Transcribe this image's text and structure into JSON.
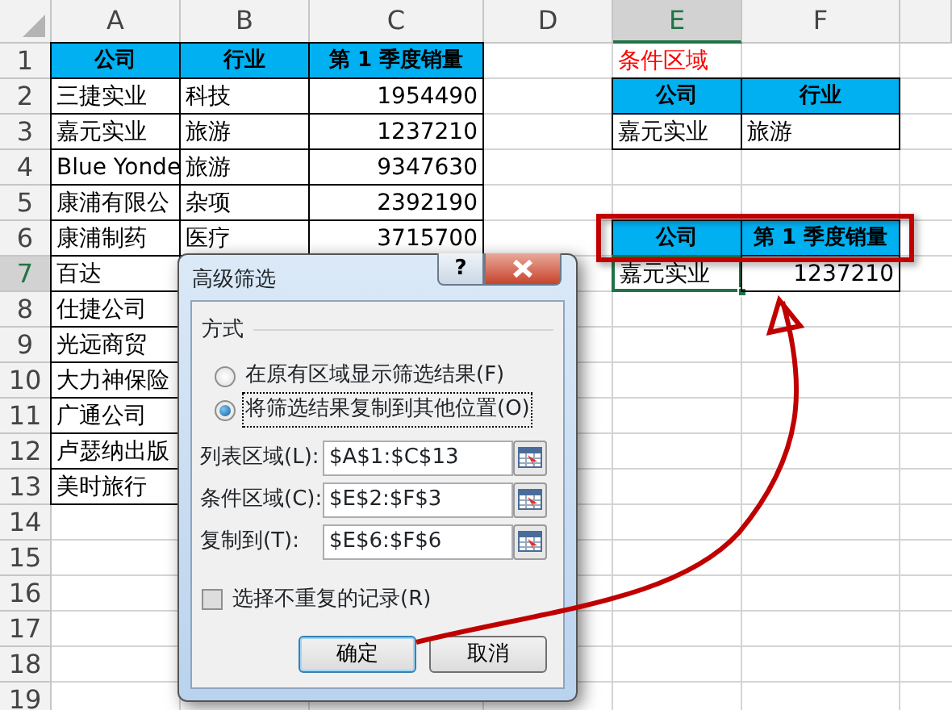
{
  "columns": [
    {
      "label": "A",
      "selected": false
    },
    {
      "label": "B",
      "selected": false
    },
    {
      "label": "C",
      "selected": false
    },
    {
      "label": "D",
      "selected": false
    },
    {
      "label": "E",
      "selected": true
    },
    {
      "label": "F",
      "selected": false
    }
  ],
  "rows": [
    {
      "label": "1",
      "selected": false,
      "cells": {
        "A": {
          "kind": "header",
          "text": "公司"
        },
        "B": {
          "kind": "header",
          "text": "行业"
        },
        "C": {
          "kind": "header",
          "text": "第 1 季度销量"
        },
        "E": {
          "kind": "note",
          "text": "条件区域"
        }
      }
    },
    {
      "label": "2",
      "selected": false,
      "cells": {
        "A": {
          "kind": "text",
          "text": "三捷实业"
        },
        "B": {
          "kind": "text",
          "text": "科技"
        },
        "C": {
          "kind": "number",
          "text": "1954490"
        },
        "E": {
          "kind": "header",
          "text": "公司"
        },
        "F": {
          "kind": "header",
          "text": "行业"
        }
      }
    },
    {
      "label": "3",
      "selected": false,
      "cells": {
        "A": {
          "kind": "text",
          "text": "嘉元实业"
        },
        "B": {
          "kind": "text",
          "text": "旅游"
        },
        "C": {
          "kind": "number",
          "text": "1237210"
        },
        "E": {
          "kind": "text",
          "text": "嘉元实业"
        },
        "F": {
          "kind": "text",
          "text": "旅游"
        }
      }
    },
    {
      "label": "4",
      "selected": false,
      "cells": {
        "A": {
          "kind": "text",
          "text": "Blue Yonde"
        },
        "B": {
          "kind": "text",
          "text": "旅游"
        },
        "C": {
          "kind": "number",
          "text": "9347630"
        }
      }
    },
    {
      "label": "5",
      "selected": false,
      "cells": {
        "A": {
          "kind": "text",
          "text": "康浦有限公"
        },
        "B": {
          "kind": "text",
          "text": "杂项"
        },
        "C": {
          "kind": "number",
          "text": "2392190"
        }
      }
    },
    {
      "label": "6",
      "selected": false,
      "cells": {
        "A": {
          "kind": "text",
          "text": "康浦制药"
        },
        "B": {
          "kind": "text",
          "text": "医疗"
        },
        "C": {
          "kind": "number",
          "text": "3715700"
        },
        "E": {
          "kind": "header",
          "text": "公司"
        },
        "F": {
          "kind": "header",
          "text": "第 1 季度销量"
        }
      }
    },
    {
      "label": "7",
      "selected": true,
      "cells": {
        "A": {
          "kind": "text",
          "text": "百达"
        },
        "E": {
          "kind": "text",
          "text": "嘉元实业",
          "selected": true
        },
        "F": {
          "kind": "number",
          "text": "1237210"
        }
      }
    },
    {
      "label": "8",
      "selected": false,
      "cells": {
        "A": {
          "kind": "text",
          "text": "仕捷公司"
        }
      }
    },
    {
      "label": "9",
      "selected": false,
      "cells": {
        "A": {
          "kind": "text",
          "text": "光远商贸"
        }
      }
    },
    {
      "label": "10",
      "selected": false,
      "cells": {
        "A": {
          "kind": "text",
          "text": "大力神保险"
        }
      }
    },
    {
      "label": "11",
      "selected": false,
      "cells": {
        "A": {
          "kind": "text",
          "text": "广通公司"
        }
      }
    },
    {
      "label": "12",
      "selected": false,
      "cells": {
        "A": {
          "kind": "text",
          "text": "卢瑟纳出版"
        }
      }
    },
    {
      "label": "13",
      "selected": false,
      "cells": {
        "A": {
          "kind": "text",
          "text": "美时旅行"
        }
      }
    },
    {
      "label": "14",
      "selected": false,
      "cells": {}
    },
    {
      "label": "15",
      "selected": false,
      "cells": {}
    },
    {
      "label": "16",
      "selected": false,
      "cells": {}
    },
    {
      "label": "17",
      "selected": false,
      "cells": {}
    },
    {
      "label": "18",
      "selected": false,
      "cells": {}
    },
    {
      "label": "19",
      "selected": false,
      "cells": {}
    }
  ],
  "dialog": {
    "title": "高级筛选",
    "help": "?",
    "group": "方式",
    "radios": [
      {
        "label": "在原有区域显示筛选结果(F)",
        "selected": false,
        "focused": false
      },
      {
        "label": "将筛选结果复制到其他位置(O)",
        "selected": true,
        "focused": true
      }
    ],
    "fields": [
      {
        "label": "列表区域(L):",
        "value": "$A$1:$C$13"
      },
      {
        "label": "条件区域(C):",
        "value": "$E$2:$F$3"
      },
      {
        "label": "复制到(T):",
        "value": "$E$6:$F$6"
      }
    ],
    "checkbox": {
      "label": "选择不重复的记录(R)",
      "checked": false
    },
    "buttons": [
      {
        "label": "确定",
        "default": true
      },
      {
        "label": "取消",
        "default": false
      }
    ]
  }
}
